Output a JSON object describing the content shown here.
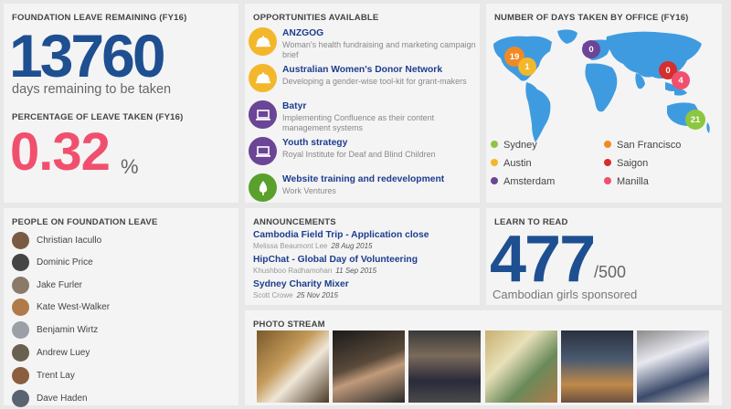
{
  "leave": {
    "title": "FOUNDATION LEAVE REMAINING (FY16)",
    "days_remaining": "13760",
    "days_label": "days remaining to be taken",
    "pct_title": "PERCENTAGE OF LEAVE TAKEN (FY16)",
    "pct_value": "0.32",
    "pct_sign": "%"
  },
  "opportunities": {
    "title": "OPPORTUNITIES AVAILABLE",
    "items": [
      {
        "title": "ANZGOG",
        "desc": "Woman's health fundraising and marketing campaign brief",
        "icon": "hardhat-icon",
        "color": "#f3b72c"
      },
      {
        "title": "Australian Women's Donor Network",
        "desc": "Developing a gender-wise tool-kit for grant-makers",
        "icon": "hardhat-icon",
        "color": "#f3b72c"
      },
      {
        "title": "Batyr",
        "desc": "Implementing Confluence as their content management systems",
        "icon": "laptop-icon",
        "color": "#6b4596"
      },
      {
        "title": "Youth strategy",
        "desc": "Royal Institute for Deaf and Blind Children",
        "icon": "laptop-icon",
        "color": "#6b4596"
      },
      {
        "title": "Website training and redevelopment",
        "desc": "Work Ventures",
        "icon": "tree-icon",
        "color": "#5aa02c"
      }
    ]
  },
  "offices": {
    "title": "NUMBER OF DAYS TAKEN BY OFFICE (FY16)",
    "pins": [
      {
        "city": "San Francisco",
        "value": "19",
        "color": "#f08a24"
      },
      {
        "city": "Austin",
        "value": "1",
        "color": "#f3b72c"
      },
      {
        "city": "Amsterdam",
        "value": "0",
        "color": "#6b4596"
      },
      {
        "city": "Saigon",
        "value": "0",
        "color": "#d62d2d"
      },
      {
        "city": "Manilla",
        "value": "4",
        "color": "#f0506e"
      },
      {
        "city": "Sydney",
        "value": "21",
        "color": "#8dc63f"
      }
    ],
    "legend": [
      {
        "label": "Sydney",
        "color": "#8dc63f"
      },
      {
        "label": "San Francisco",
        "color": "#f08a24"
      },
      {
        "label": "Austin",
        "color": "#f3b72c"
      },
      {
        "label": "Saigon",
        "color": "#d62d2d"
      },
      {
        "label": "Amsterdam",
        "color": "#6b4596"
      },
      {
        "label": "Manilla",
        "color": "#f0506e"
      }
    ],
    "map_color": "#3f9be0"
  },
  "people": {
    "title": "PEOPLE ON FOUNDATION LEAVE",
    "list": [
      "Christian Iacullo",
      "Dominic Price",
      "Jake Furler",
      "Kate West-Walker",
      "Benjamin Wirtz",
      "Andrew Luey",
      "Trent Lay",
      "Dave Haden"
    ]
  },
  "announcements": {
    "title": "ANNOUNCEMENTS",
    "items": [
      {
        "title": "Cambodia Field Trip - Application close",
        "author": "Melissa Beaumont Lee",
        "date": "28 Aug 2015"
      },
      {
        "title": "HipChat - Global Day of Volunteering",
        "author": "Khushboo Radhamohan",
        "date": "11 Sep 2015"
      },
      {
        "title": "Sydney Charity Mixer",
        "author": "Scott Crowe",
        "date": "25 Nov 2015"
      }
    ]
  },
  "learn": {
    "title": "LEARN TO READ",
    "value": "477",
    "of": "/500",
    "subtitle": "Cambodian girls sponsored"
  },
  "photos": {
    "title": "PHOTO STREAM",
    "count": 6
  }
}
